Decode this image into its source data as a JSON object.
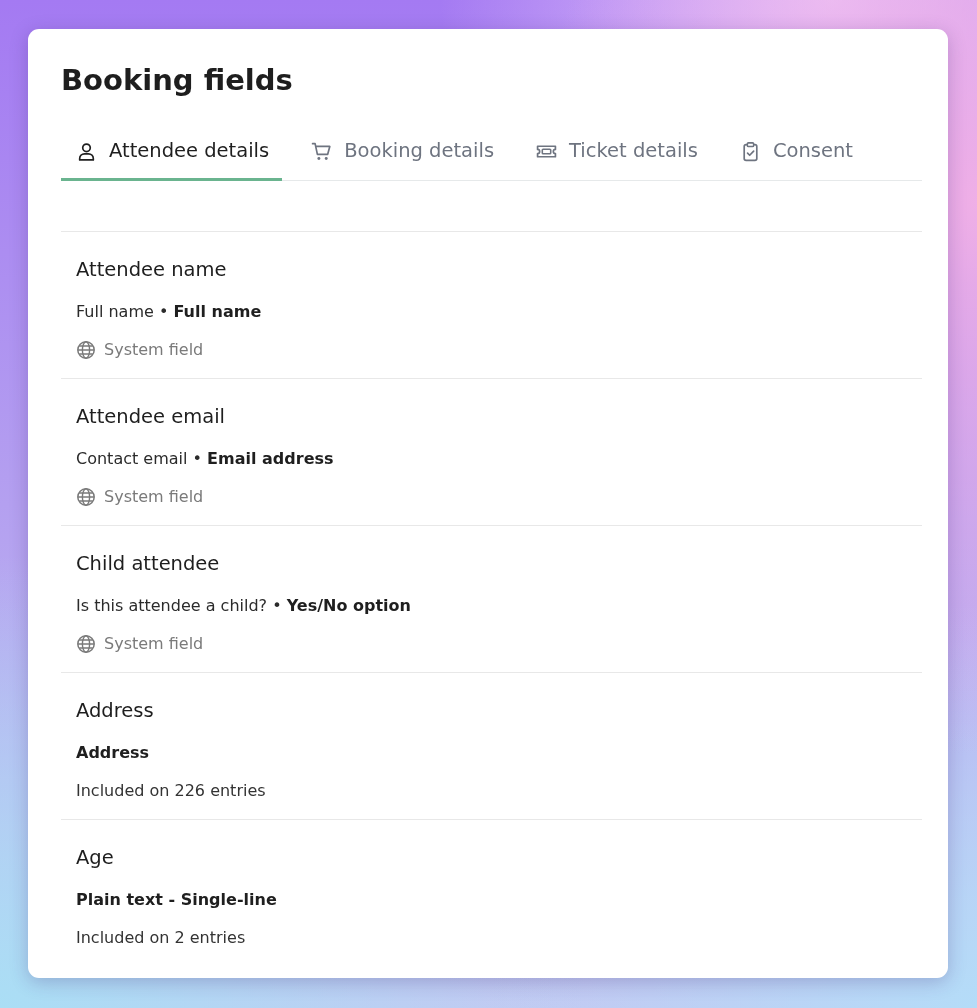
{
  "page": {
    "title": "Booking fields"
  },
  "tabs": [
    {
      "label": "Attendee details",
      "selected": true
    },
    {
      "label": "Booking details",
      "selected": false
    },
    {
      "label": "Ticket details",
      "selected": false
    },
    {
      "label": "Consent",
      "selected": false
    }
  ],
  "fields": [
    {
      "name": "Attendee name",
      "description": {
        "question": "Full name",
        "separator": "•",
        "field_type": "Full name"
      },
      "meta": {
        "kind": "system",
        "text": "System field"
      }
    },
    {
      "name": "Attendee email",
      "description": {
        "question": "Contact email",
        "separator": "•",
        "field_type": "Email address"
      },
      "meta": {
        "kind": "system",
        "text": "System field"
      }
    },
    {
      "name": "Child attendee",
      "description": {
        "question": "Is this attendee a child?",
        "separator": "•",
        "field_type": "Yes/No option"
      },
      "meta": {
        "kind": "system",
        "text": "System field"
      }
    },
    {
      "name": "Address",
      "description": {
        "field_type": "Address"
      },
      "meta": {
        "kind": "usage",
        "text": "Included on 226 entries"
      }
    },
    {
      "name": "Age",
      "description": {
        "field_type": "Plain text - Single-line"
      },
      "meta": {
        "kind": "usage",
        "text": "Included on 2 entries"
      }
    }
  ]
}
